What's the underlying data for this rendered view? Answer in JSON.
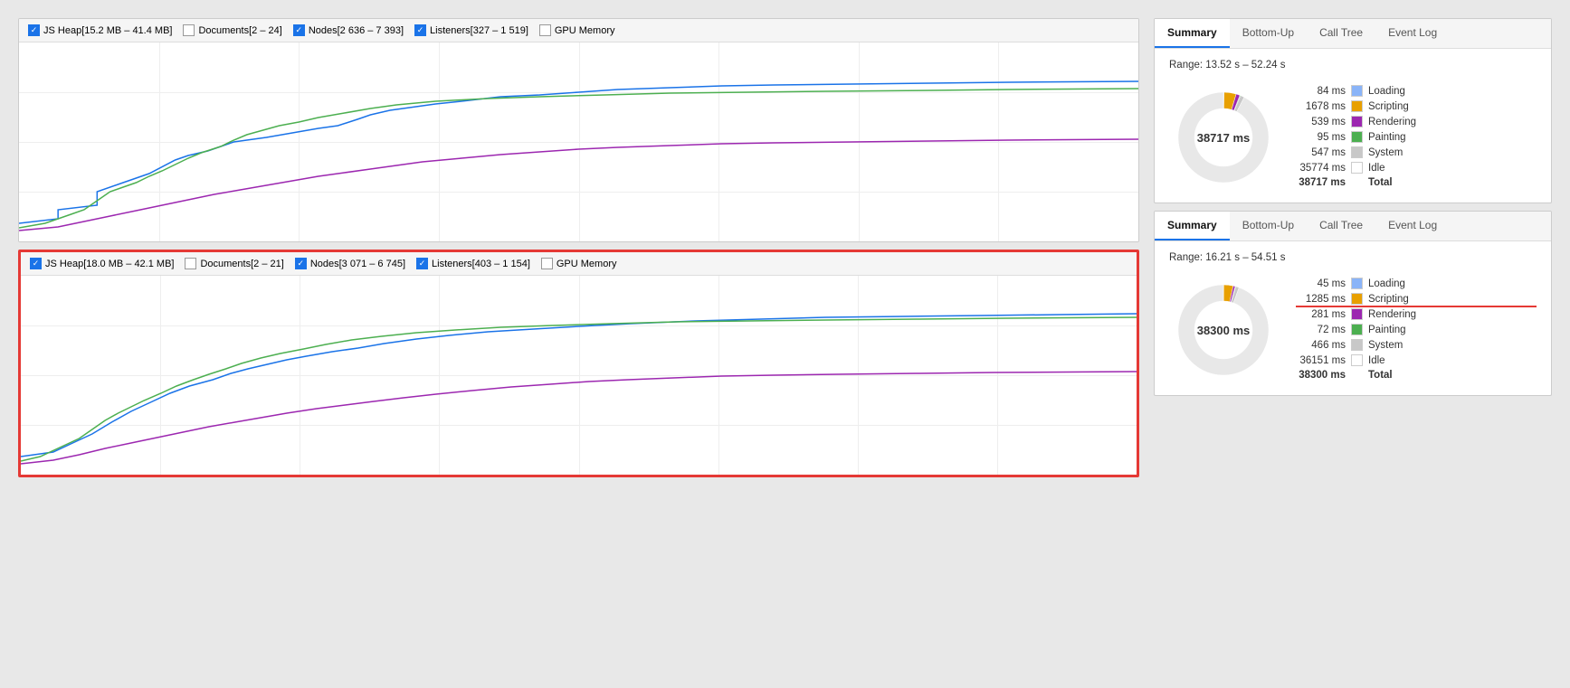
{
  "left": {
    "chart1": {
      "legend": [
        {
          "id": "js-heap-1",
          "checked": true,
          "color": "#1a73e8",
          "label": "JS Heap[15.2 MB – 41.4 MB]"
        },
        {
          "id": "documents-1",
          "checked": false,
          "color": "#f4a261",
          "label": "Documents[2 – 24]"
        },
        {
          "id": "nodes-1",
          "checked": true,
          "color": "#4caf50",
          "label": "Nodes[2 636 – 7 393]"
        },
        {
          "id": "listeners-1",
          "checked": true,
          "color": "#9c27b0",
          "label": "Listeners[327 – 1 519]"
        },
        {
          "id": "gpu-1",
          "checked": false,
          "color": "#e91e63",
          "label": "GPU Memory"
        }
      ]
    },
    "chart2": {
      "highlighted": true,
      "legend": [
        {
          "id": "js-heap-2",
          "checked": true,
          "color": "#1a73e8",
          "label": "JS Heap[18.0 MB – 42.1 MB]"
        },
        {
          "id": "documents-2",
          "checked": false,
          "color": "#f4a261",
          "label": "Documents[2 – 21]"
        },
        {
          "id": "nodes-2",
          "checked": true,
          "color": "#4caf50",
          "label": "Nodes[3 071 – 6 745]"
        },
        {
          "id": "listeners-2",
          "checked": true,
          "color": "#9c27b0",
          "label": "Listeners[403 – 1 154]"
        },
        {
          "id": "gpu-2",
          "checked": false,
          "color": "#e91e63",
          "label": "GPU Memory"
        }
      ]
    }
  },
  "right": {
    "panel1": {
      "tabs": [
        "Summary",
        "Bottom-Up",
        "Call Tree",
        "Event Log"
      ],
      "activeTab": "Summary",
      "range": "Range: 13.52 s – 52.24 s",
      "centerLabel": "38717 ms",
      "stats": [
        {
          "value": "84 ms",
          "color": "#8ab4f8",
          "label": "Loading",
          "underline": false
        },
        {
          "value": "1678 ms",
          "color": "#e8a000",
          "label": "Scripting",
          "underline": false
        },
        {
          "value": "539 ms",
          "color": "#9c27b0",
          "label": "Rendering",
          "underline": false
        },
        {
          "value": "95 ms",
          "color": "#4caf50",
          "label": "Painting",
          "underline": false
        },
        {
          "value": "547 ms",
          "color": "#c8c8c8",
          "label": "System",
          "underline": false
        },
        {
          "value": "35774 ms",
          "color": "#ffffff",
          "label": "Idle",
          "underline": false
        },
        {
          "value": "38717 ms",
          "color": null,
          "label": "Total",
          "total": true,
          "underline": false
        }
      ]
    },
    "panel2": {
      "tabs": [
        "Summary",
        "Bottom-Up",
        "Call Tree",
        "Event Log"
      ],
      "activeTab": "Summary",
      "range": "Range: 16.21 s – 54.51 s",
      "centerLabel": "38300 ms",
      "stats": [
        {
          "value": "45 ms",
          "color": "#8ab4f8",
          "label": "Loading",
          "underline": false
        },
        {
          "value": "1285 ms",
          "color": "#e8a000",
          "label": "Scripting",
          "underline": true
        },
        {
          "value": "281 ms",
          "color": "#9c27b0",
          "label": "Rendering",
          "underline": false
        },
        {
          "value": "72 ms",
          "color": "#4caf50",
          "label": "Painting",
          "underline": false
        },
        {
          "value": "466 ms",
          "color": "#c8c8c8",
          "label": "System",
          "underline": false
        },
        {
          "value": "36151 ms",
          "color": "#ffffff",
          "label": "Idle",
          "underline": false
        },
        {
          "value": "38300 ms",
          "color": null,
          "label": "Total",
          "total": true,
          "underline": false
        }
      ]
    }
  }
}
